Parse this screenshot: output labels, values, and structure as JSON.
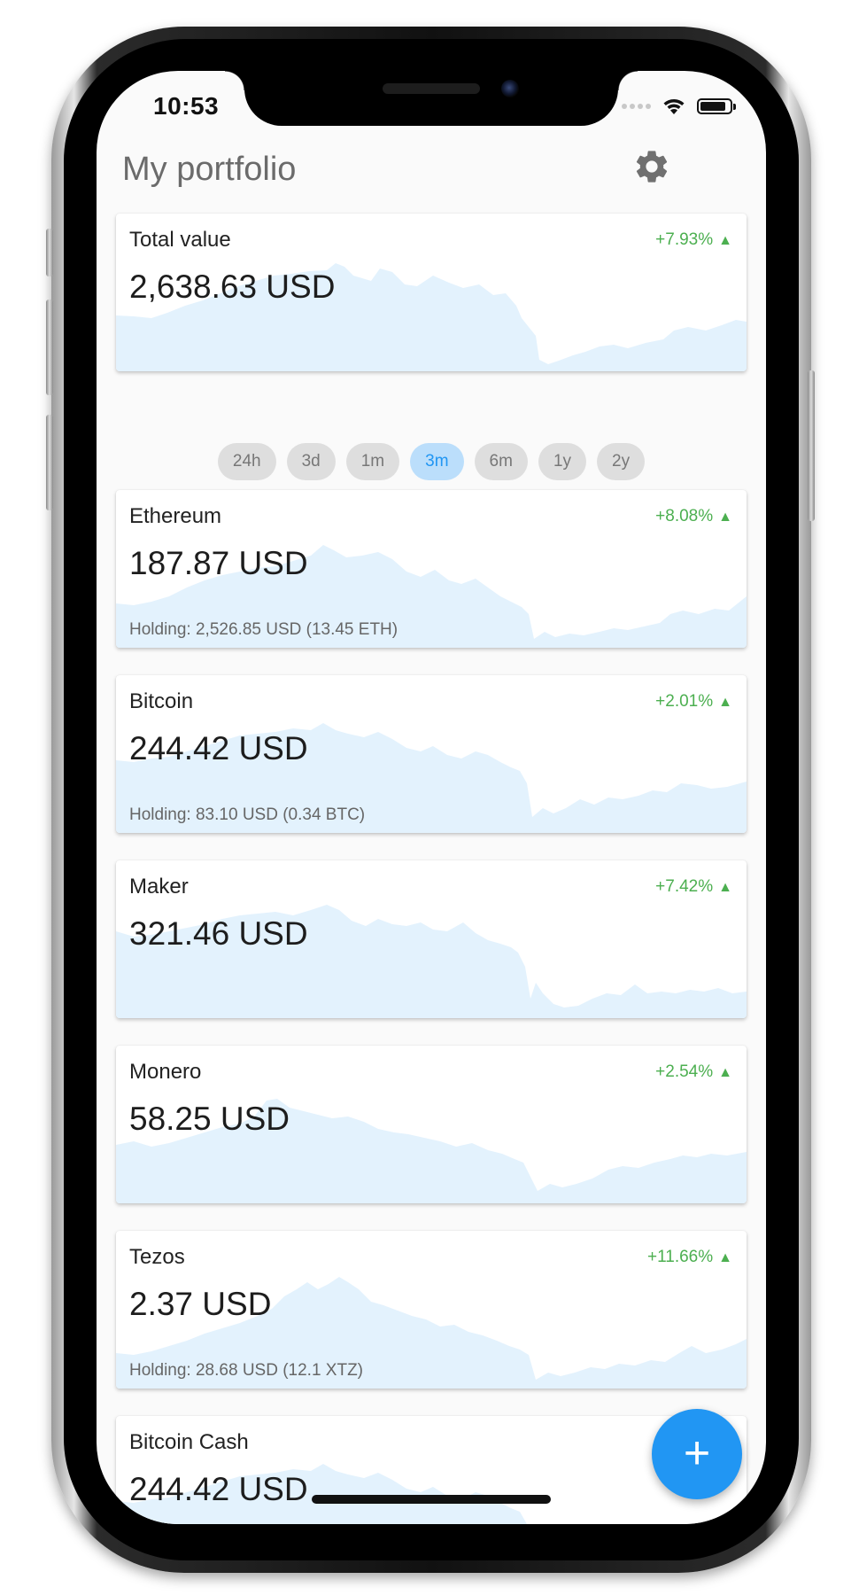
{
  "status_bar": {
    "time": "10:53"
  },
  "header": {
    "title": "My portfolio",
    "settings_icon": "gear-icon"
  },
  "total": {
    "label": "Total value",
    "value": "2,638.63 USD",
    "change": "+7.93%"
  },
  "time_ranges": {
    "options": [
      "24h",
      "3d",
      "1m",
      "3m",
      "6m",
      "1y",
      "2y"
    ],
    "selected": "3m"
  },
  "assets": [
    {
      "name": "Ethereum",
      "value": "187.87 USD",
      "change": "+8.08%",
      "holding": "Holding: 2,526.85 USD (13.45 ETH)"
    },
    {
      "name": "Bitcoin",
      "value": "244.42 USD",
      "change": "+2.01%",
      "holding": "Holding: 83.10 USD (0.34 BTC)"
    },
    {
      "name": "Maker",
      "value": "321.46 USD",
      "change": "+7.42%",
      "holding": ""
    },
    {
      "name": "Monero",
      "value": "58.25 USD",
      "change": "+2.54%",
      "holding": ""
    },
    {
      "name": "Tezos",
      "value": "2.37 USD",
      "change": "+11.66%",
      "holding": "Holding: 28.68 USD (12.1 XTZ)"
    },
    {
      "name": "Bitcoin Cash",
      "value": "244.42 USD",
      "change": "",
      "holding": ""
    }
  ],
  "fab": {
    "label": "+",
    "icon": "add-icon"
  },
  "colors": {
    "accent": "#2196f3",
    "positive": "#4caf50",
    "sparkline_fill": "#e3f2fd",
    "chip_active_bg": "#bbdefb",
    "chip_bg": "#dedede"
  }
}
